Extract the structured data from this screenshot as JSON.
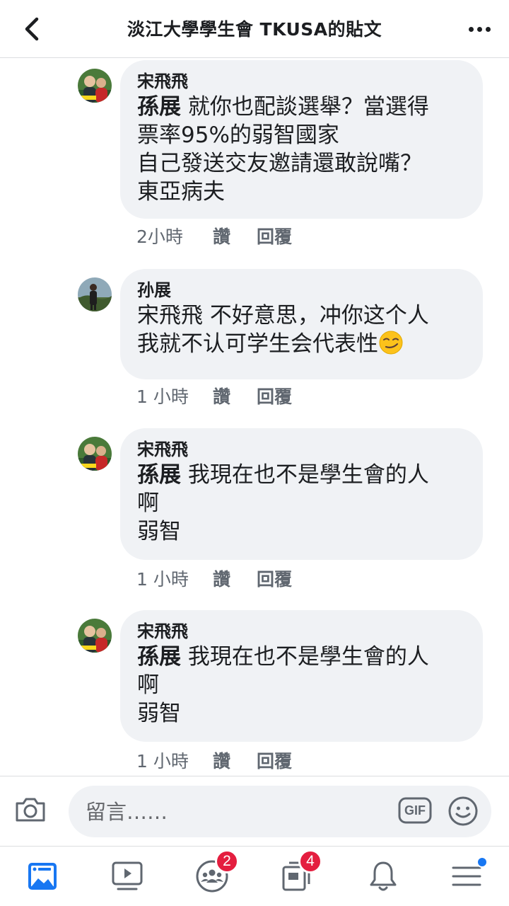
{
  "header": {
    "title": "淡江大學學生會 TKUSA的貼文"
  },
  "comments": [
    {
      "author": "宋飛飛",
      "mention": "孫展",
      "text_first": " 就你也配談選舉？當選得",
      "text_rest": "票率95%的弱智國家\n自己發送交友邀請還敢說嘴？\n東亞病夫",
      "time": "2小時",
      "like": "讚",
      "reply": "回覆"
    },
    {
      "author": "孙展",
      "mention": "",
      "text_first": "宋飛飛 不好意思，冲你这个人",
      "text_rest": "我就不认可学生会代表性",
      "time": "1 小時",
      "like": "讚",
      "reply": "回覆"
    },
    {
      "author": "宋飛飛",
      "mention": "孫展",
      "text_first": " 我現在也不是學生會的人",
      "text_rest": "啊\n弱智",
      "time": "1 小時",
      "like": "讚",
      "reply": "回覆"
    },
    {
      "author": "宋飛飛",
      "mention": "孫展",
      "text_first": " 我現在也不是學生會的人",
      "text_rest": "啊\n弱智",
      "time": "1 小時",
      "like": "讚",
      "reply": "回覆"
    }
  ],
  "composer": {
    "placeholder": "留言……",
    "gif_label": "GIF"
  },
  "tabbar": {
    "groups_badge": "2",
    "pages_badge": "4"
  },
  "colors": {
    "accent": "#1877f2",
    "badge": "#e41e3f",
    "bubble": "#f0f2f5"
  }
}
